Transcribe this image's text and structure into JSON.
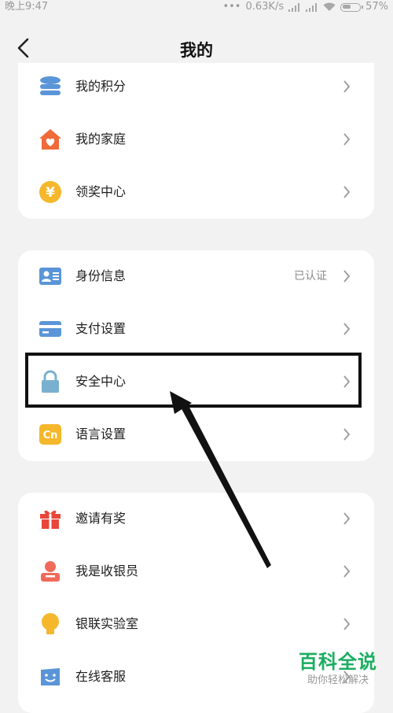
{
  "status_bar": {
    "time": "晚上9:47",
    "network_speed": "0.63K/s",
    "battery": "57%",
    "battery_level": 0.57
  },
  "header": {
    "title": "我的"
  },
  "group1": [
    {
      "label": "我的积分",
      "icon": "coins-stack-icon"
    },
    {
      "label": "我的家庭",
      "icon": "home-heart-icon"
    },
    {
      "label": "领奖中心",
      "icon": "yuan-coin-icon"
    }
  ],
  "group2": [
    {
      "label": "身份信息",
      "value": "已认证",
      "icon": "id-card-icon"
    },
    {
      "label": "支付设置",
      "icon": "bank-card-icon"
    },
    {
      "label": "安全中心",
      "icon": "lock-icon"
    },
    {
      "label": "语言设置",
      "icon": "language-cn-icon",
      "icon_text": "Cn"
    }
  ],
  "group3": [
    {
      "label": "邀请有奖",
      "icon": "gift-icon"
    },
    {
      "label": "我是收银员",
      "icon": "cashier-icon"
    },
    {
      "label": "银联实验室",
      "icon": "lightbulb-icon"
    },
    {
      "label": "在线客服",
      "icon": "chat-smile-icon"
    }
  ],
  "watermark": {
    "logo": "百科全说",
    "sub": "助你轻松解决"
  },
  "colors": {
    "accent_blue": "#5a95d8",
    "orange": "#f06a3a",
    "yellow": "#f5b72b",
    "red": "#e8463b",
    "watermark_green": "#1aad60"
  }
}
